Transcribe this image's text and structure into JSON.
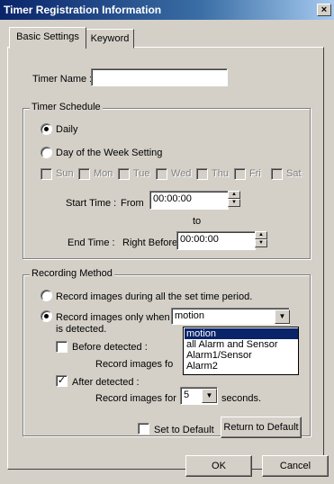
{
  "window": {
    "title": "Timer Registration Information",
    "close_symbol": "×"
  },
  "tabs": [
    {
      "label": "Basic Settings",
      "active": true
    },
    {
      "label": "Keyword",
      "active": false
    }
  ],
  "timer_name": {
    "label": "Timer Name :",
    "value": ""
  },
  "schedule": {
    "group_label": "Timer Schedule",
    "daily_label": "Daily",
    "dow_label": "Day of the Week Setting",
    "selected": "daily",
    "days": [
      "Sun",
      "Mon",
      "Tue",
      "Wed",
      "Thu",
      "Fri",
      "Sat"
    ],
    "start_label": "Start Time :",
    "from_label": "From",
    "start_value": "00:00:00",
    "to_label": "to",
    "end_label": "End Time :",
    "right_before_label": "Right Before",
    "end_value": "00:00:00"
  },
  "recording": {
    "group_label": "Recording Method",
    "all_period_label": "Record images during all the set time period.",
    "only_when_label": "Record images only when",
    "is_detected_label": "is detected.",
    "selected": "only_when",
    "trigger_value": "motion",
    "trigger_options": [
      "motion",
      "all Alarm and Sensor",
      "Alarm1/Sensor",
      "Alarm2"
    ],
    "trigger_selected_index": 0,
    "before_label": "Before detected :",
    "before_checked": false,
    "before_record_label": "Record images fo",
    "after_label": "After detected :",
    "after_checked": true,
    "after_record_label": "Record images for",
    "after_seconds": "5",
    "seconds_label": "seconds."
  },
  "defaults": {
    "set_default_label": "Set to Default",
    "set_default_checked": false,
    "return_label": "Return to Default"
  },
  "buttons": {
    "ok": "OK",
    "cancel": "Cancel"
  },
  "check_mark": "✓",
  "icons": {
    "spin_up": "▲",
    "spin_down": "▼",
    "dropdown": "▼"
  },
  "colors": {
    "title_bar": "#0a246a",
    "dialog_face": "#d4d0c8",
    "selection": "#0a246a"
  }
}
